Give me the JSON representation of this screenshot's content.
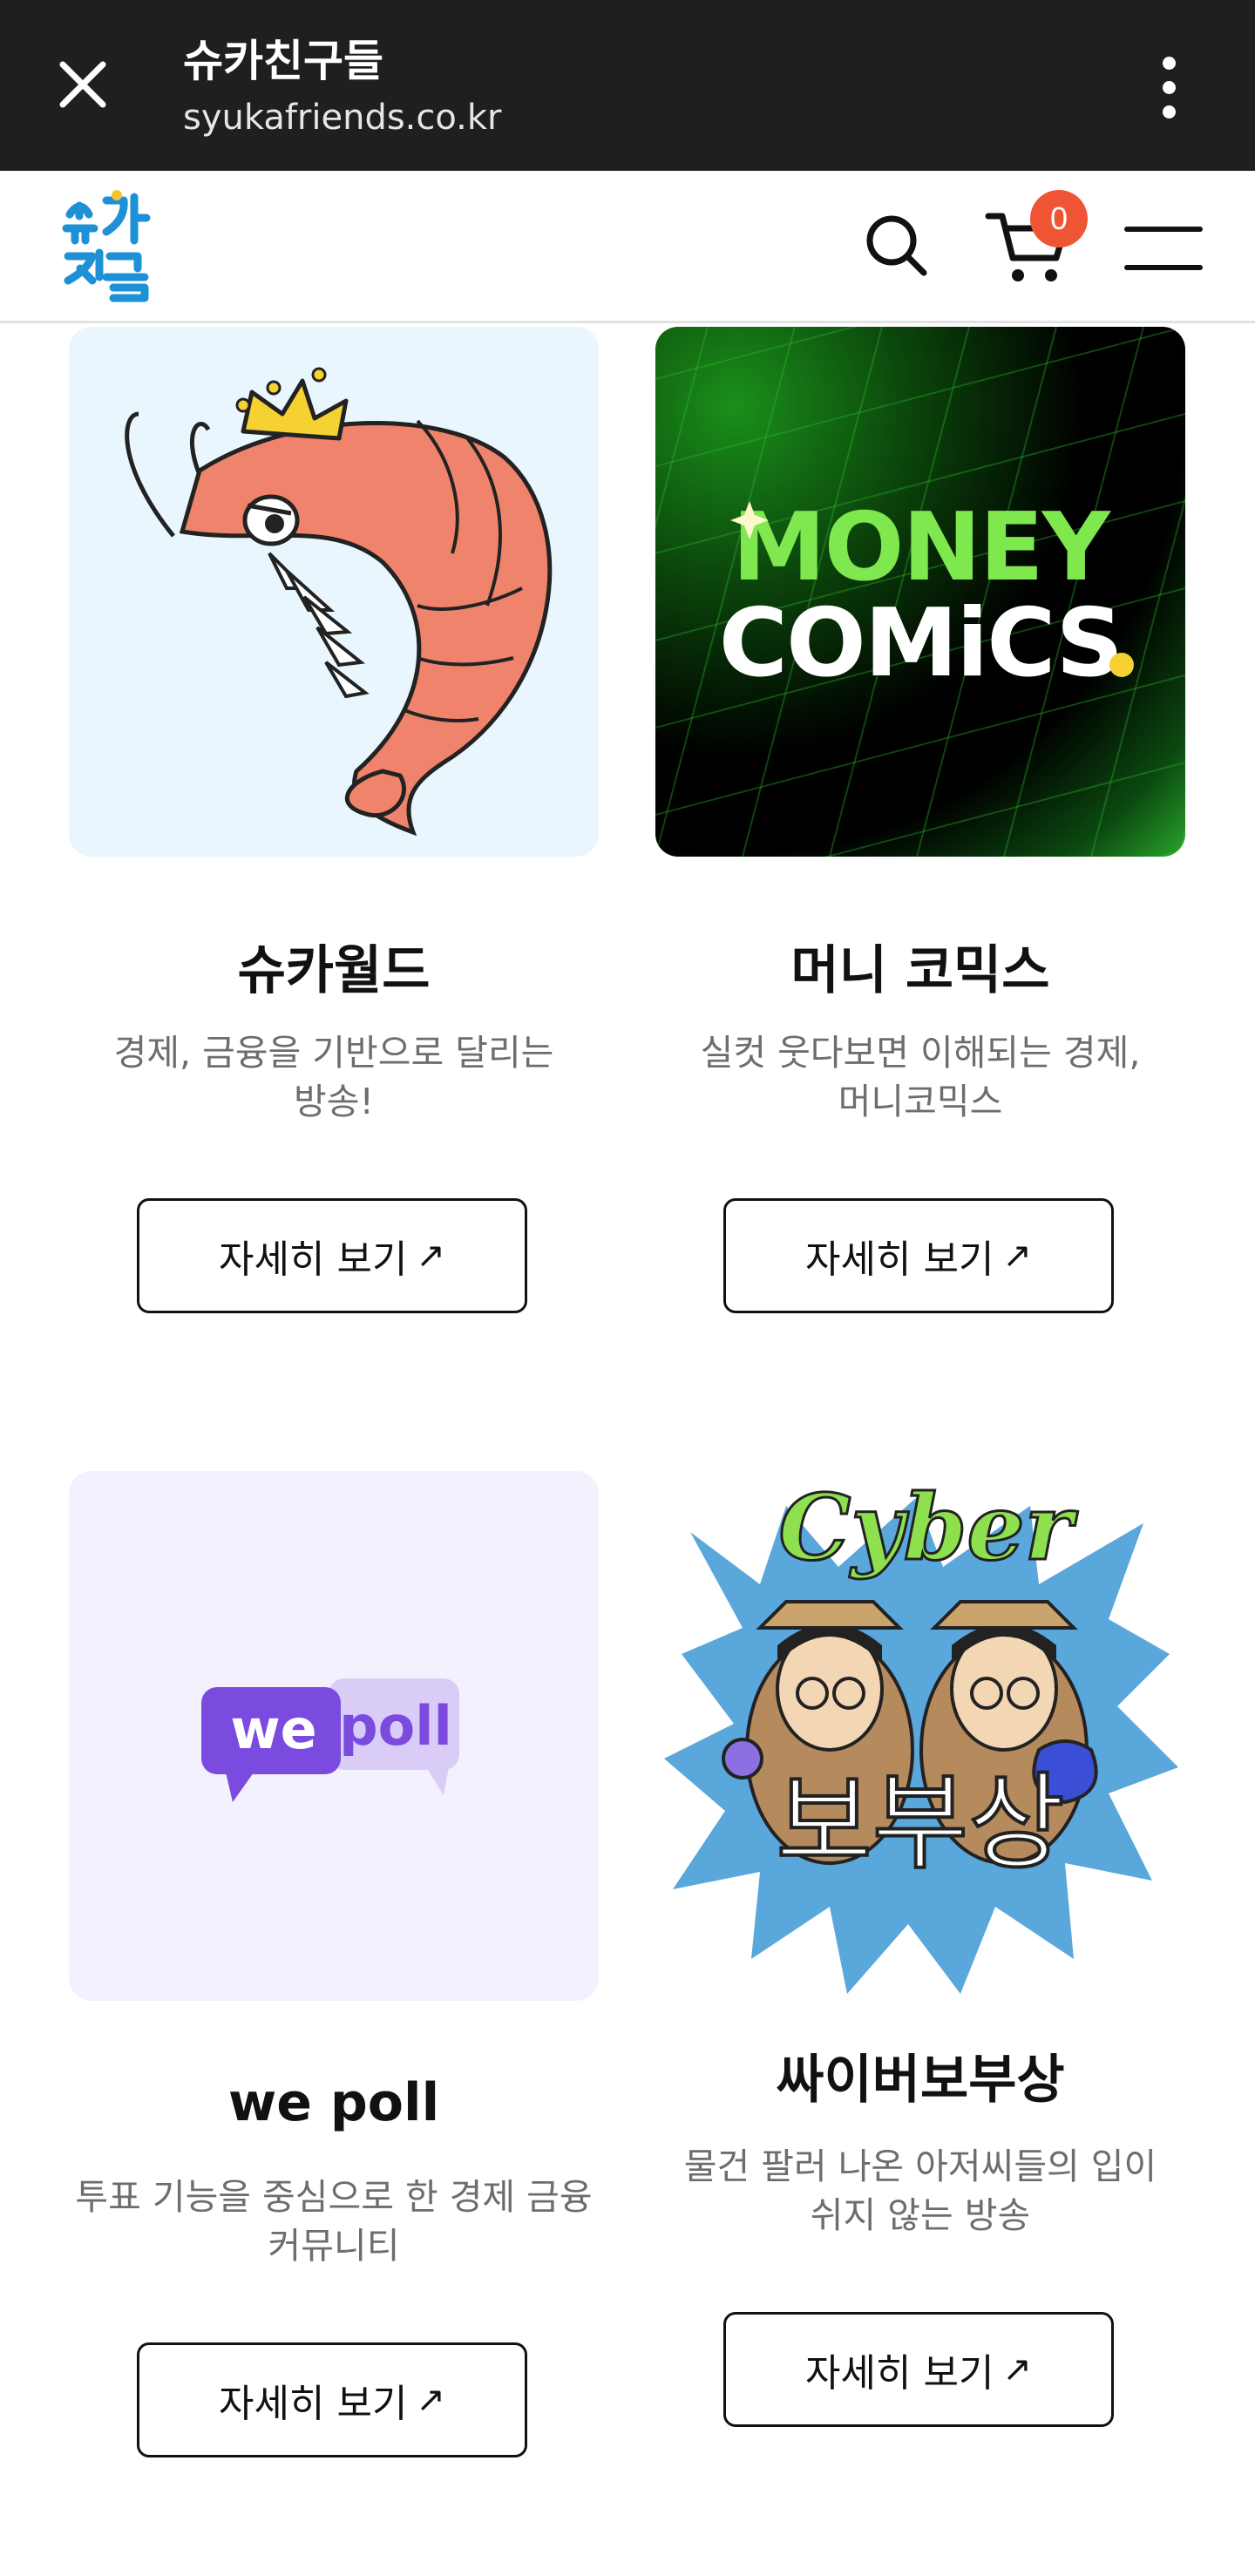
{
  "browser": {
    "title": "슈카친구들",
    "url": "syukafriends.co.kr"
  },
  "header": {
    "logo_alt": "슈카친구",
    "cart_count": "0"
  },
  "cards": [
    {
      "title": "슈카월드",
      "description_lines": [
        "경제, 금융을 기반으로 달리는",
        "방송!"
      ],
      "button_label": "자세히 보기",
      "button_icon": "arrow-up-right-icon"
    },
    {
      "title": "머니 코믹스",
      "description_lines": [
        "실컷 웃다보면 이해되는 경제,",
        "머니코믹스"
      ],
      "button_label": "자세히 보기",
      "button_icon": "arrow-up-right-icon",
      "thumb_text": [
        "MONEY",
        "COMiCS"
      ]
    },
    {
      "title": "we poll",
      "description_lines": [
        "투표 기능을 중심으로 한 경제 금융",
        "커뮤니티"
      ],
      "button_label": "자세히 보기",
      "button_icon": "arrow-up-right-icon",
      "thumb_text": [
        "we",
        "poll"
      ]
    },
    {
      "title": "싸이버보부상",
      "description_lines": [
        "물건 팔러 나온 아저씨들의 입이",
        "쉬지 않는 방송"
      ],
      "button_label": "자세히 보기",
      "button_icon": "arrow-up-right-icon",
      "thumb_text": [
        "Cyber",
        "보부상"
      ]
    }
  ],
  "colors": {
    "chrome_bg": "#1f1f1f",
    "cart_badge": "#ef5534",
    "logo_blue": "#1e90d6",
    "money_green": "#7ee84e",
    "wepoll_purple": "#7b4be0"
  }
}
